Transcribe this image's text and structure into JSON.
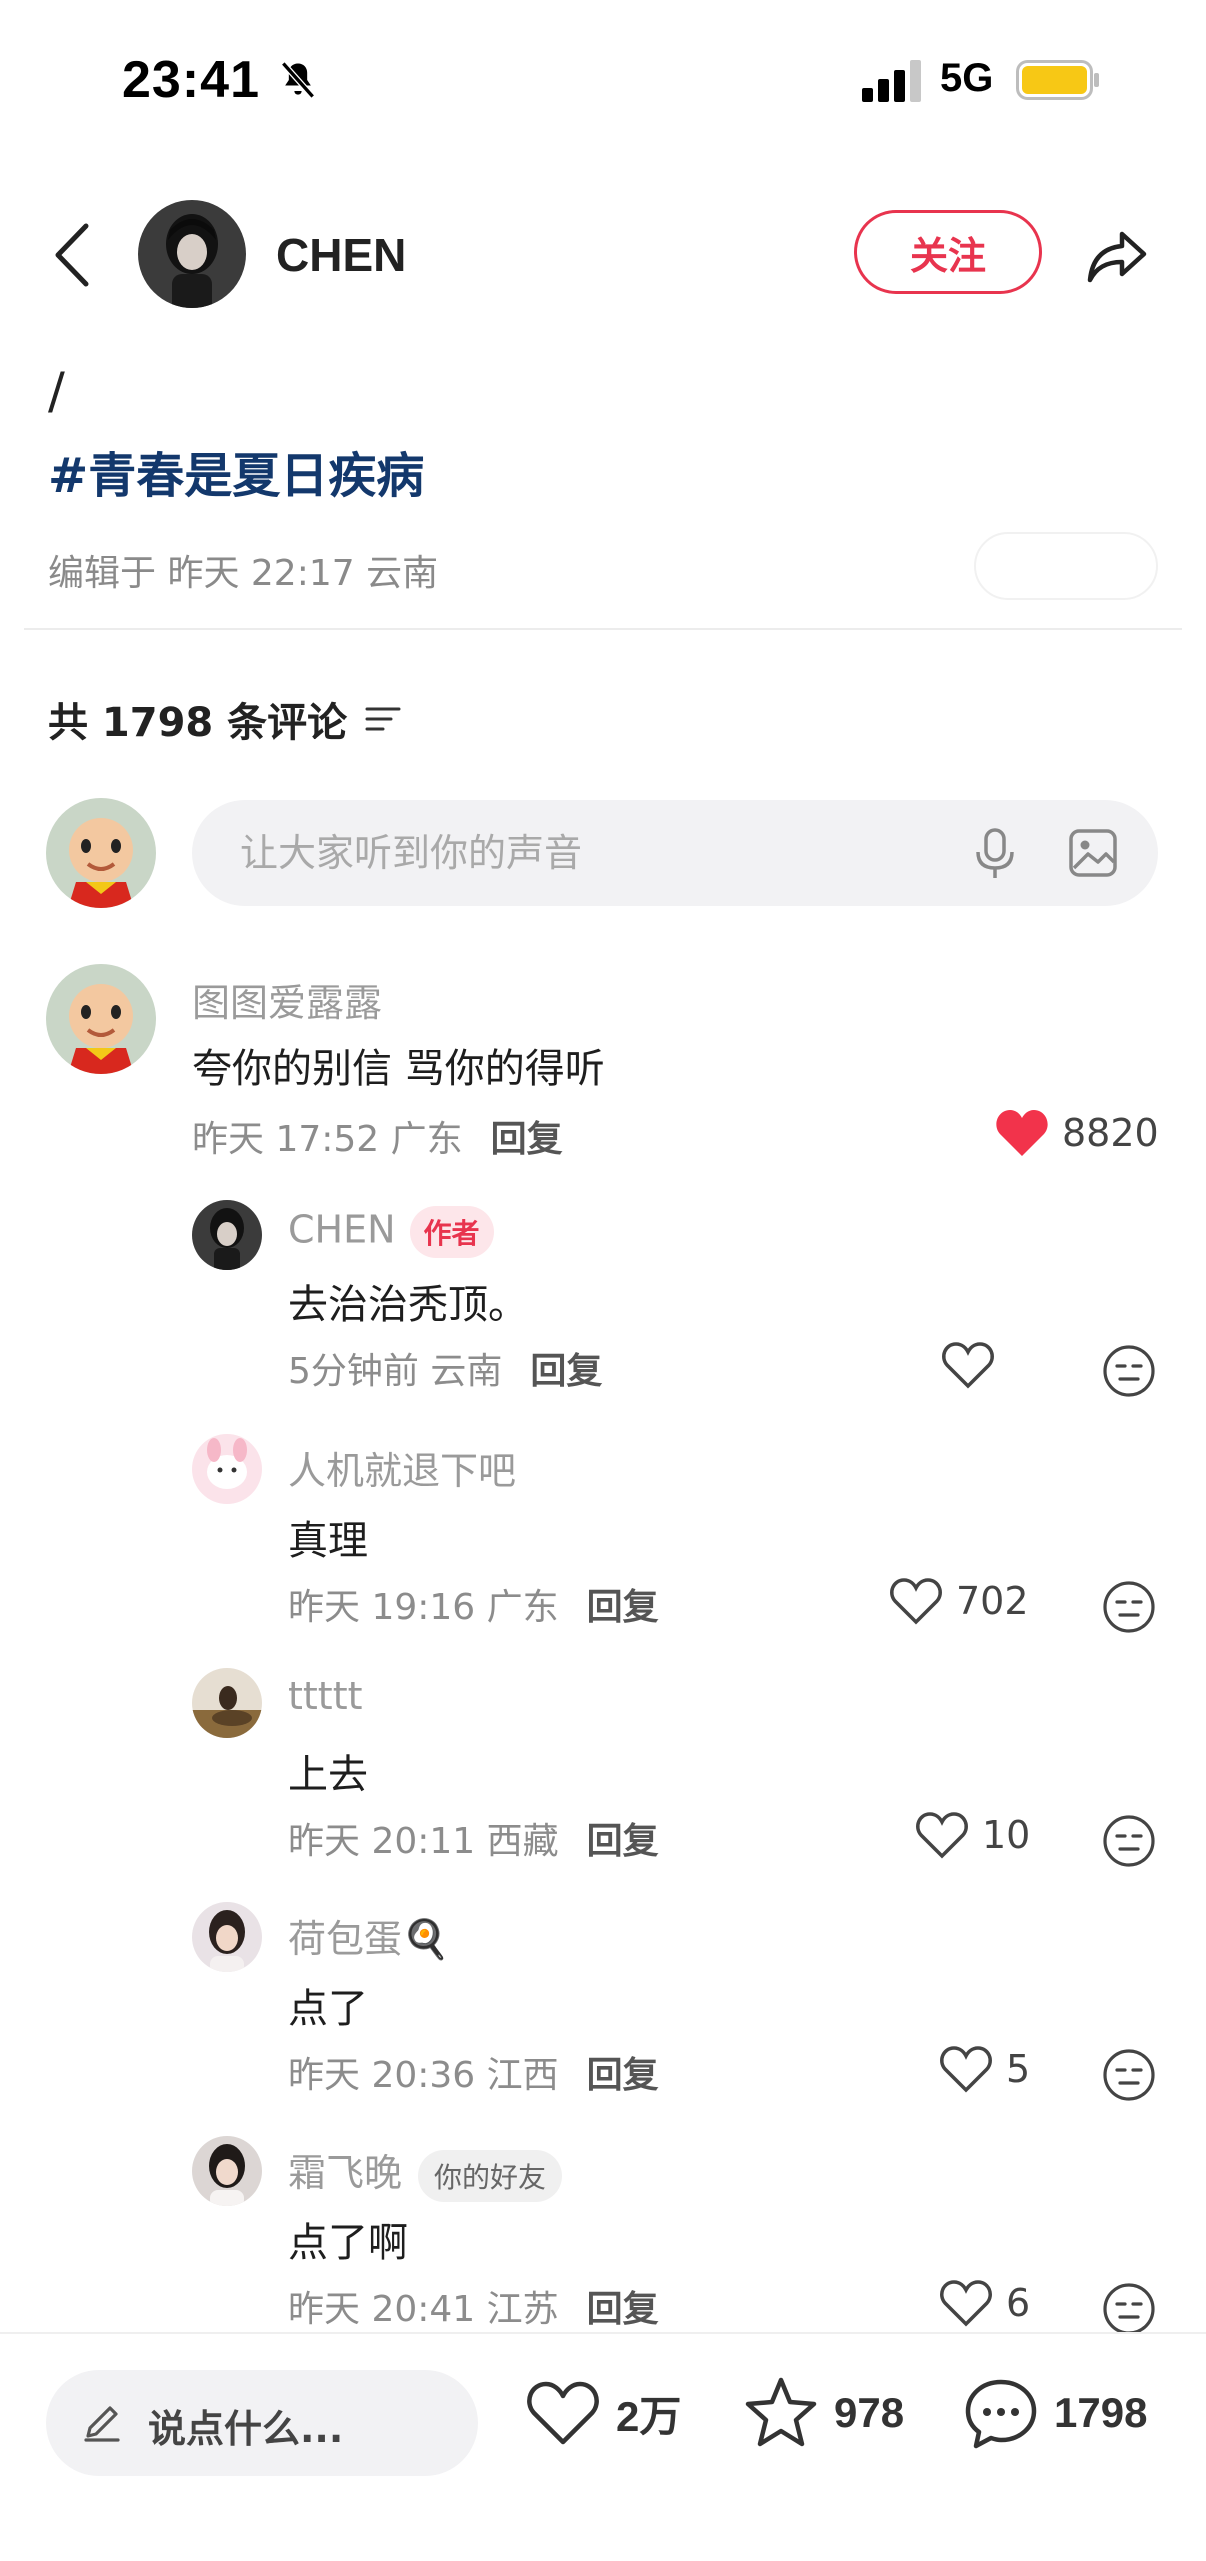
{
  "status_bar": {
    "time": "23:41",
    "network": "5G",
    "battery_color": "#f7c815"
  },
  "header": {
    "author_name": "CHEN",
    "follow_label": "关注"
  },
  "post": {
    "slash": "/",
    "hashtag": "#青春是夏日疾病",
    "meta": "编辑于 昨天 22:17 云南"
  },
  "comments_header": {
    "count_label": "共 1798 条评论"
  },
  "comment_input": {
    "placeholder": "让大家听到你的声音"
  },
  "comments": [
    {
      "name": "图图爱露露",
      "text": "夸你的别信 骂你的得听",
      "time": "昨天 17:52 广东",
      "reply": "回复",
      "likes": "8820",
      "liked": true
    },
    {
      "name": "CHEN",
      "badge": "作者",
      "text": "去治治秃顶。",
      "time": "5分钟前 云南",
      "reply": "回复",
      "likes": ""
    },
    {
      "name": "人机就退下吧",
      "text": "真理",
      "time": "昨天 19:16 广东",
      "reply": "回复",
      "likes": "702"
    },
    {
      "name": "ttttt",
      "text": "上去",
      "time": "昨天 20:11 西藏",
      "reply": "回复",
      "likes": "10"
    },
    {
      "name": "荷包蛋🍳",
      "text": "点了",
      "time": "昨天 20:36 江西",
      "reply": "回复",
      "likes": "5"
    },
    {
      "name": "霜飞晚",
      "badge": "你的好友",
      "text": "点了啊",
      "time": "昨天 20:41 江苏",
      "reply": "回复",
      "likes": "6"
    }
  ],
  "bottom_bar": {
    "say_placeholder": "说点什么...",
    "likes": "2万",
    "favorites": "978",
    "comments": "1798"
  },
  "colors": {
    "accent": "#e8344e",
    "hashtag": "#13386c"
  }
}
